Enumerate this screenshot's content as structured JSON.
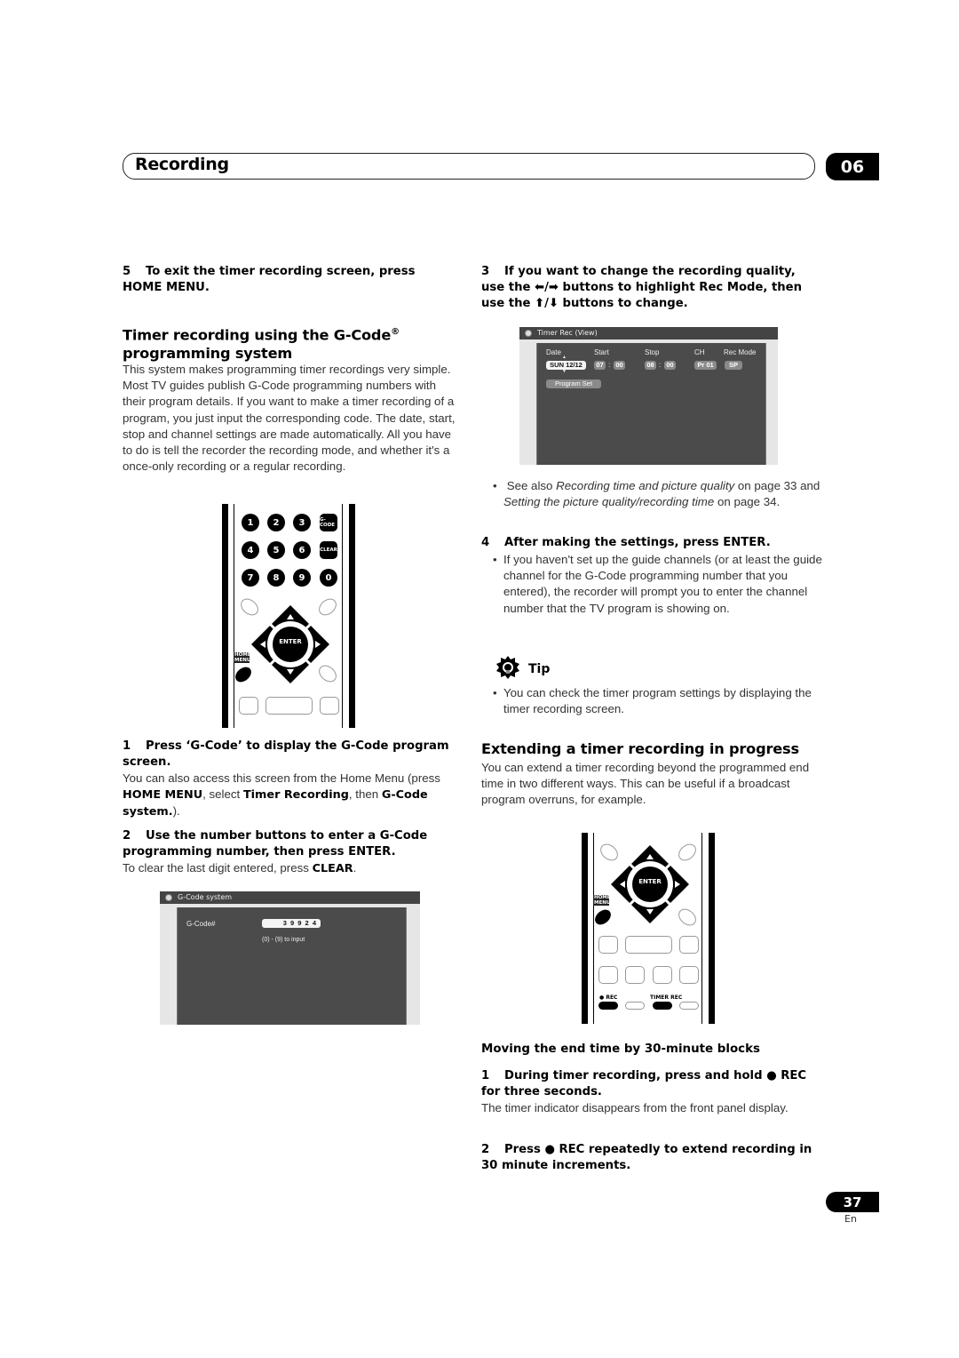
{
  "header": {
    "section_title": "Recording",
    "chapter_number": "06"
  },
  "left": {
    "step5": {
      "num": "5",
      "text": "To exit the timer recording screen, press HOME MENU."
    },
    "section_heading": {
      "line1": "Timer recording using the G-Code",
      "registered": "®",
      "line2": "programming system"
    },
    "intro": "This system makes programming timer recordings very simple. Most TV guides publish G-Code programming numbers with their program details. If you want to make a timer recording of a program, you just input the corresponding code. The date, start, stop and channel settings are made automatically. All you have to do is tell the recorder the recording mode, and whether it's a once-only recording or a regular recording.",
    "remote": {
      "buttons": [
        "1",
        "2",
        "3",
        "G-CODE",
        "4",
        "5",
        "6",
        "CLEAR",
        "7",
        "8",
        "9",
        "0"
      ],
      "enter_label": "ENTER",
      "home_menu_label": "HOME MENU"
    },
    "step1": {
      "num": "1",
      "text": "Press ‘G-Code’ to display the G-Code program screen."
    },
    "step1_body": {
      "pre": "You can also access this screen from the Home Menu (press ",
      "b1": "HOME MENU",
      "mid": ", select ",
      "b2": "Timer Recording",
      "mid2": ", then ",
      "b3": "G-Code system.",
      "post": ")."
    },
    "step2": {
      "num": "2",
      "text": "Use the number buttons to enter a G-Code programming number, then press ENTER."
    },
    "step2_body": {
      "pre": "To clear the last digit entered, press ",
      "b1": "CLEAR",
      "post": "."
    },
    "gcode_screen": {
      "title": "G-Code system",
      "field_label": "G-Code#",
      "field_value": "3 9 9 2 4",
      "hint": "(0) - (9) to input"
    }
  },
  "right": {
    "step3": {
      "num": "3",
      "text_a": "If you want to change the recording quality, use the ",
      "arrows_lr": "⬅/➡",
      "text_b": " buttons to highlight Rec Mode, then use the ",
      "arrows_ud": "⬆/⬇",
      "text_c": " buttons to change."
    },
    "timer_screen": {
      "title": "Timer Rec (View)",
      "columns": [
        "Date",
        "Start",
        "Stop",
        "CH",
        "Rec Mode"
      ],
      "date": "SUN 12/12",
      "start_h": "07",
      "start_m": "00",
      "stop_h": "08",
      "stop_m": "00",
      "ch": "Pr 01",
      "rec_mode": "SP",
      "colon": ":",
      "program_set": "Program Set"
    },
    "see_also": {
      "pre": "See also ",
      "i1": "Recording time and picture quality",
      "mid": " on page 33 and ",
      "i2": "Setting the picture quality/recording time",
      "post": " on page 34."
    },
    "step4": {
      "num": "4",
      "text": "After making the settings, press ENTER."
    },
    "step4_bullet": "If you haven't set up the guide channels (or at least the guide channel for the G-Code programming number that you entered), the recorder will prompt you to enter the channel number that the TV program is showing on.",
    "tip": {
      "label": "Tip",
      "bullet": "You can check the timer program settings by displaying the timer recording screen."
    },
    "extend_heading": "Extending a timer recording in progress",
    "extend_body": "You can extend a timer recording beyond the programmed end time in two different ways. This can be useful if a broadcast program overruns, for example.",
    "remote2": {
      "enter_label": "ENTER",
      "home_menu_label": "HOME MENU",
      "rec_label": "● REC",
      "timer_rec_label": "TIMER REC"
    },
    "subheading": "Moving the end time by 30-minute blocks",
    "sub_step1": {
      "num": "1",
      "text": "During timer recording, press and hold ● REC for three seconds."
    },
    "sub_step1_body": "The timer indicator disappears from the front panel display.",
    "sub_step2": {
      "num": "2",
      "text": "Press ● REC repeatedly to extend recording in 30 minute increments."
    }
  },
  "footer": {
    "page_number": "37",
    "language": "En"
  }
}
